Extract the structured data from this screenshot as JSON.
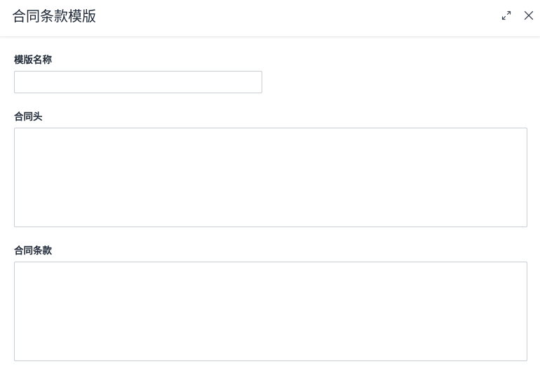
{
  "dialog": {
    "title": "合同条款模版",
    "expand_icon": "expand-icon",
    "close_icon": "close-icon"
  },
  "form": {
    "template_name": {
      "label": "模版名称",
      "value": "",
      "placeholder": ""
    },
    "contract_header": {
      "label": "合同头",
      "value": "",
      "placeholder": ""
    },
    "contract_terms": {
      "label": "合同条款",
      "value": "",
      "placeholder": ""
    }
  }
}
